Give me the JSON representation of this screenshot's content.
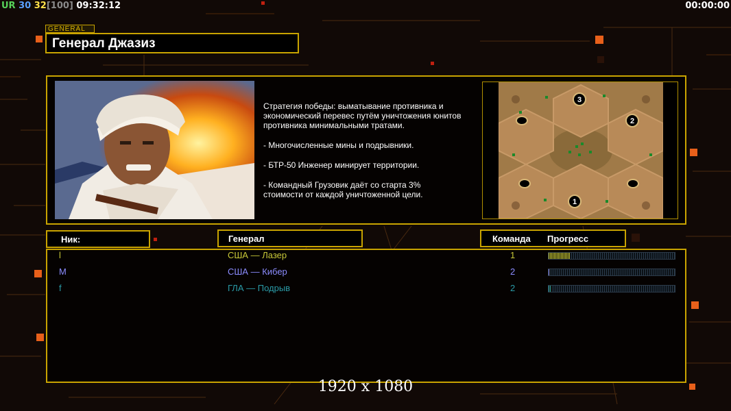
{
  "top_bar": {
    "ur_label": "UR",
    "val1": "30",
    "val2": "32",
    "bracket": "[100]",
    "time": "09:32:12",
    "elapsed": "00:00:00"
  },
  "general": {
    "tag": "GENERAL",
    "name": "Генерал Джазиз"
  },
  "strategy": [
    "Стратегия победы: выматывание противника и\n экономический перевес путём уничтожения юнитов\n противника минимальными тратами.",
    "- Многочисленные мины и подрывники.",
    "- БТР-50 Инженер минирует территории.",
    "- Командный Грузовик даёт со старта 3%\n стоимости от каждой уничтоженной цели."
  ],
  "minimap": {
    "spawns": [
      "1",
      "2",
      "3"
    ]
  },
  "columns": {
    "nick": "Ник:",
    "general": "Генерал",
    "team": "Команда",
    "progress": "Прогресс"
  },
  "players": [
    {
      "nick": "l",
      "general": "США — Лазер",
      "team": "1",
      "color": "#c8c838",
      "progress": 0.17
    },
    {
      "nick": "M",
      "general": "США — Кибер",
      "team": "2",
      "color": "#8c8cff",
      "progress": 0.01
    },
    {
      "nick": "f",
      "general": "ГЛА — Подрыв",
      "team": "2",
      "color": "#2a9aa6",
      "progress": 0.02
    }
  ],
  "resolution": "1920 x 1080",
  "colors": {
    "accent": "#c9a400",
    "ur": "#57d35a",
    "val1": "#5aa0ff",
    "val2": "#ffe14a",
    "bracket": "#8a8a8a"
  }
}
